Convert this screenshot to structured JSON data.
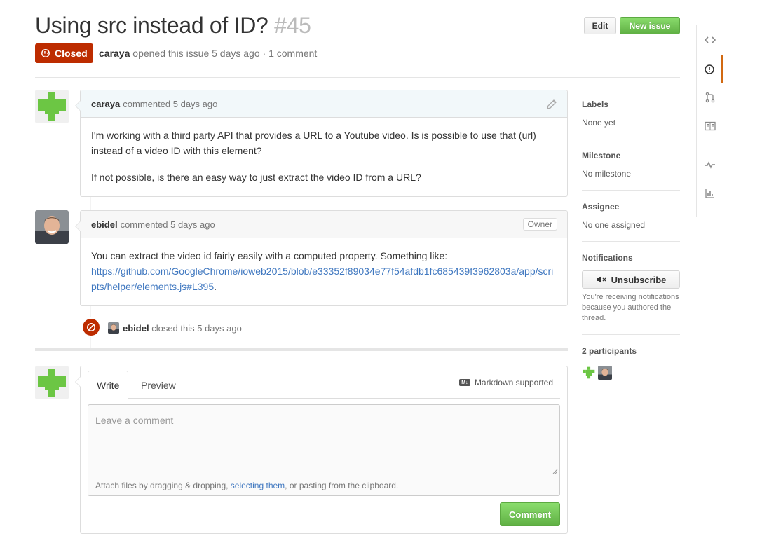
{
  "issue": {
    "title": "Using src instead of ID?",
    "number": "#45",
    "state": "Closed",
    "author": "caraya",
    "meta_text": "opened this issue 5 days ago · 1 comment"
  },
  "header_buttons": {
    "edit": "Edit",
    "new_issue": "New issue"
  },
  "comments": [
    {
      "author": "caraya",
      "action": "commented 5 days ago",
      "body": [
        "I'm working with a third party API that provides a URL to a Youtube video. Is is possible to use that (url) instead of a video ID with this element?",
        "If not possible, is there an easy way to just extract the video ID from a URL?"
      ]
    },
    {
      "author": "ebidel",
      "action": "commented 5 days ago",
      "badge": "Owner",
      "body_text": "You can extract the video id fairly easily with a computed property. Something like:",
      "link": "https://github.com/GoogleChrome/ioweb2015/blob/e33352f89034e77f54afdb1fc685439f3962803a/app/scripts/helper/elements.js#L395",
      "link_suffix": "."
    }
  ],
  "event": {
    "actor": "ebidel",
    "text": "closed this 5 days ago"
  },
  "new_comment": {
    "tab_write": "Write",
    "tab_preview": "Preview",
    "markdown_note": "Markdown supported",
    "markdown_icon": "M↓",
    "placeholder": "Leave a comment",
    "attach_prefix": "Attach files by dragging & dropping, ",
    "attach_link": "selecting them",
    "attach_suffix": ", or pasting from the clipboard.",
    "submit": "Comment"
  },
  "sidebar": {
    "labels_title": "Labels",
    "labels_value": "None yet",
    "milestone_title": "Milestone",
    "milestone_value": "No milestone",
    "assignee_title": "Assignee",
    "assignee_value": "No one assigned",
    "notifications_title": "Notifications",
    "unsubscribe": "Unsubscribe",
    "notifications_note": "You're receiving notifications because you authored the thread.",
    "participants_title": "2 participants"
  },
  "repo_nav": [
    "code-icon",
    "issues-icon",
    "pull-requests-icon",
    "wiki-icon",
    "pulse-icon",
    "graphs-icon"
  ],
  "colors": {
    "closed": "#bd2c00",
    "green": "#6cc644",
    "link": "#4078c0",
    "nav_active": "#d26911"
  }
}
